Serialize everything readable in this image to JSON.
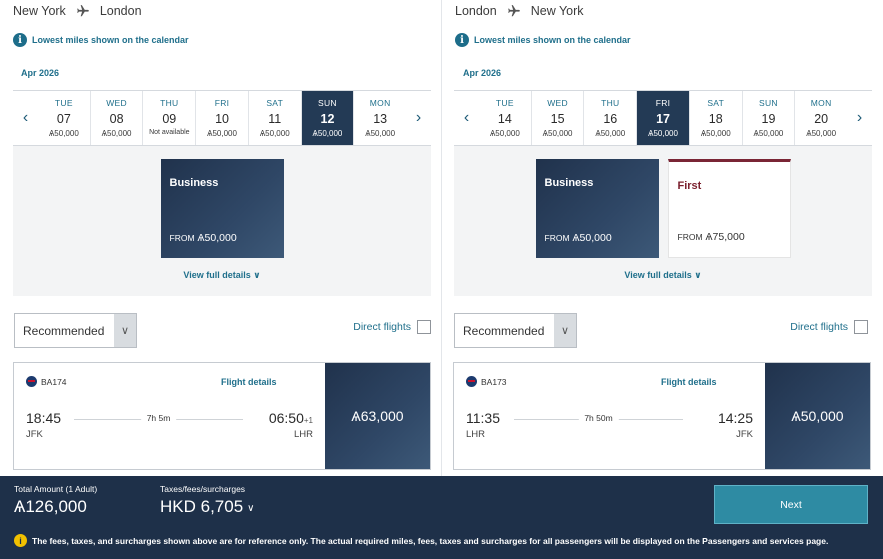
{
  "currency_symbol": "Ѧ",
  "panels": [
    {
      "route": {
        "from": "New York",
        "to": "London"
      },
      "info_text": "Lowest miles shown on the calendar",
      "month": "Apr 2026",
      "days": [
        {
          "dow": "TUE",
          "num": "07",
          "miles": "Ѧ50,000"
        },
        {
          "dow": "WED",
          "num": "08",
          "miles": "Ѧ50,000"
        },
        {
          "dow": "THU",
          "num": "09",
          "miles": "Not available"
        },
        {
          "dow": "FRI",
          "num": "10",
          "miles": "Ѧ50,000"
        },
        {
          "dow": "SAT",
          "num": "11",
          "miles": "Ѧ50,000"
        },
        {
          "dow": "SUN",
          "num": "12",
          "miles": "Ѧ50,000"
        },
        {
          "dow": "MON",
          "num": "13",
          "miles": "Ѧ50,000"
        }
      ],
      "fares": [
        {
          "cabin": "Business",
          "from_label": "FROM",
          "price": "Ѧ50,000"
        }
      ],
      "view_details": "View full details",
      "sort": "Recommended",
      "direct_label": "Direct flights",
      "flight": {
        "number": "BA174",
        "details_link": "Flight details",
        "dep_time": "18:45",
        "dep_code": "JFK",
        "duration": "7h 5m",
        "arr_time": "06:50",
        "arr_offset": "+1",
        "arr_code": "LHR",
        "price": "Ѧ63,000"
      }
    },
    {
      "route": {
        "from": "London",
        "to": "New York"
      },
      "info_text": "Lowest miles shown on the calendar",
      "month": "Apr 2026",
      "days": [
        {
          "dow": "TUE",
          "num": "14",
          "miles": "Ѧ50,000"
        },
        {
          "dow": "WED",
          "num": "15",
          "miles": "Ѧ50,000"
        },
        {
          "dow": "THU",
          "num": "16",
          "miles": "Ѧ50,000"
        },
        {
          "dow": "FRI",
          "num": "17",
          "miles": "Ѧ50,000"
        },
        {
          "dow": "SAT",
          "num": "18",
          "miles": "Ѧ50,000"
        },
        {
          "dow": "SUN",
          "num": "19",
          "miles": "Ѧ50,000"
        },
        {
          "dow": "MON",
          "num": "20",
          "miles": "Ѧ50,000"
        }
      ],
      "fares": [
        {
          "cabin": "Business",
          "from_label": "FROM",
          "price": "Ѧ50,000"
        },
        {
          "cabin": "First",
          "from_label": "FROM",
          "price": "Ѧ75,000"
        }
      ],
      "view_details": "View full details",
      "sort": "Recommended",
      "direct_label": "Direct flights",
      "flight": {
        "number": "BA173",
        "details_link": "Flight details",
        "dep_time": "11:35",
        "dep_code": "LHR",
        "duration": "7h 50m",
        "arr_time": "14:25",
        "arr_offset": "",
        "arr_code": "JFK",
        "price": "Ѧ50,000"
      }
    }
  ],
  "footer": {
    "total_label": "Total Amount (1 Adult)",
    "total_value": "Ѧ126,000",
    "tax_label": "Taxes/fees/surcharges",
    "tax_value": "HKD 6,705",
    "next_label": "Next",
    "notice": "The fees, taxes, and surcharges shown above are for reference only. The actual required miles, fees, taxes and surcharges for all passengers will be displayed on the Passengers and services page."
  },
  "icons": {
    "plane": "plane-icon",
    "info": "info-icon",
    "warning": "warning-icon",
    "airline": "british-airways-logo"
  }
}
